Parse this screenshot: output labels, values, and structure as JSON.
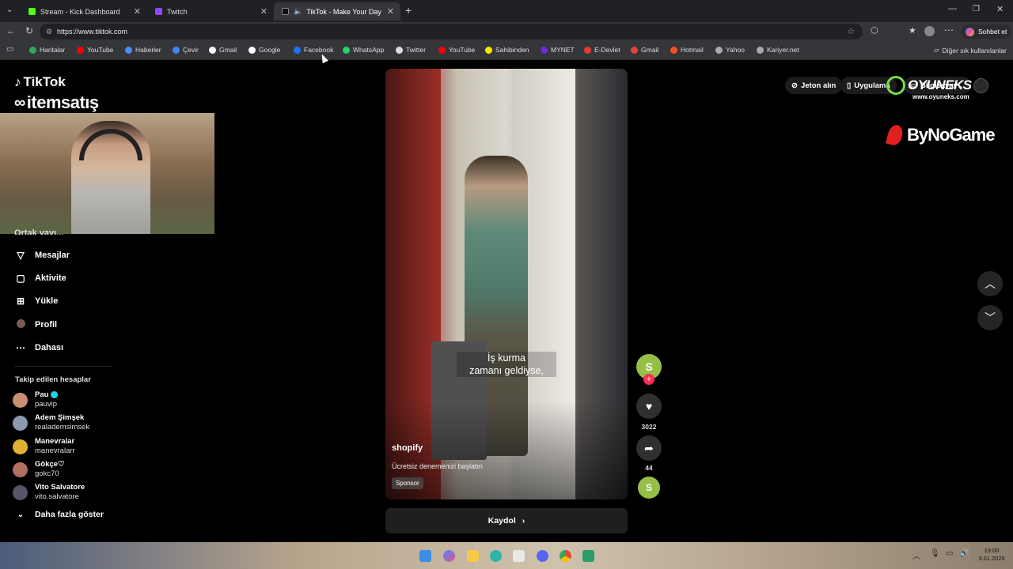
{
  "tabs": [
    {
      "label": "Stream - Kick Dashboard",
      "color": "#53fc18"
    },
    {
      "label": "Twitch",
      "color": "#9146ff"
    },
    {
      "label": "TikTok - Make Your Day",
      "color": "#111111"
    }
  ],
  "address": {
    "url": "https://www.tiktok.com"
  },
  "chrome_right": {
    "copilot_label": "Sohbet et"
  },
  "bookmarks": [
    {
      "label": "Haritalar",
      "color": "#34a853"
    },
    {
      "label": "YouTube",
      "color": "#ff0000"
    },
    {
      "label": "Haberler",
      "color": "#4a8af4"
    },
    {
      "label": "Çevir",
      "color": "#4285f4"
    },
    {
      "label": "Gmail",
      "color": "#ffffff"
    },
    {
      "label": "Google",
      "color": "#ffffff"
    },
    {
      "label": "Facebook",
      "color": "#1877f2"
    },
    {
      "label": "WhatsApp",
      "color": "#25d366"
    },
    {
      "label": "Twitter",
      "color": "#dddddd"
    },
    {
      "label": "YouTube",
      "color": "#ff0000"
    },
    {
      "label": "Sahibinden",
      "color": "#ffe800"
    },
    {
      "label": "MYNET",
      "color": "#6d28d9"
    },
    {
      "label": "E-Devlet",
      "color": "#e53935"
    },
    {
      "label": "Gmail",
      "color": "#ea4335"
    },
    {
      "label": "Hotmail",
      "color": "#f25022"
    },
    {
      "label": "Yahoo",
      "color": "#aaaaaa"
    },
    {
      "label": "Kariyer.net",
      "color": "#aaaaaa"
    }
  ],
  "other_bookmarks": "Diğer sık kullanılanlar",
  "tiktok": {
    "logo": "TikTok",
    "sidebar": {
      "partial_item": "Ortak yayı...",
      "items": [
        {
          "label": "Mesajlar",
          "icon": "send-icon"
        },
        {
          "label": "Aktivite",
          "icon": "message-icon"
        },
        {
          "label": "Yükle",
          "icon": "plus-square-icon"
        },
        {
          "label": "Profil",
          "icon": "profile-icon"
        },
        {
          "label": "Dahası",
          "icon": "more-icon"
        }
      ],
      "following_title": "Takip edilen hesaplar",
      "following": [
        {
          "name": "Pau",
          "handle": "pauvip",
          "color": "#c89070"
        },
        {
          "name": "Adem Şimşek",
          "handle": "realademsimsek",
          "color": "#8a9ab0"
        },
        {
          "name": "Manevralar",
          "handle": "manevralarr",
          "color": "#e0b030"
        },
        {
          "name": "Gökçe♡",
          "handle": "gokc70",
          "color": "#b07060"
        },
        {
          "name": "Vito Salvatore",
          "handle": "vito.salvatore",
          "color": "#555566"
        }
      ],
      "show_more": "Daha fazla göster"
    },
    "header": {
      "coins": "Jeton alın",
      "app": "Uygulama",
      "pc": "Bilgisayar ..."
    },
    "video": {
      "caption_line1": "İş kurma",
      "caption_line2": "zamanı geldiyse,",
      "author": "shopify",
      "description": "Ücretsiz denemenizi başlatın",
      "badge": "Sponsor"
    },
    "actions": {
      "likes": "3022",
      "shares": "44"
    },
    "signup": "Kaydol"
  },
  "overlays": {
    "itemsatis": "itemsatış",
    "oyuneks": "OYUNEKS",
    "oyuneks_url": "www.oyuneks.com",
    "bynogame": "ByNoGame"
  },
  "taskbar": {
    "time": "19:00",
    "date": "3.01.2026"
  }
}
